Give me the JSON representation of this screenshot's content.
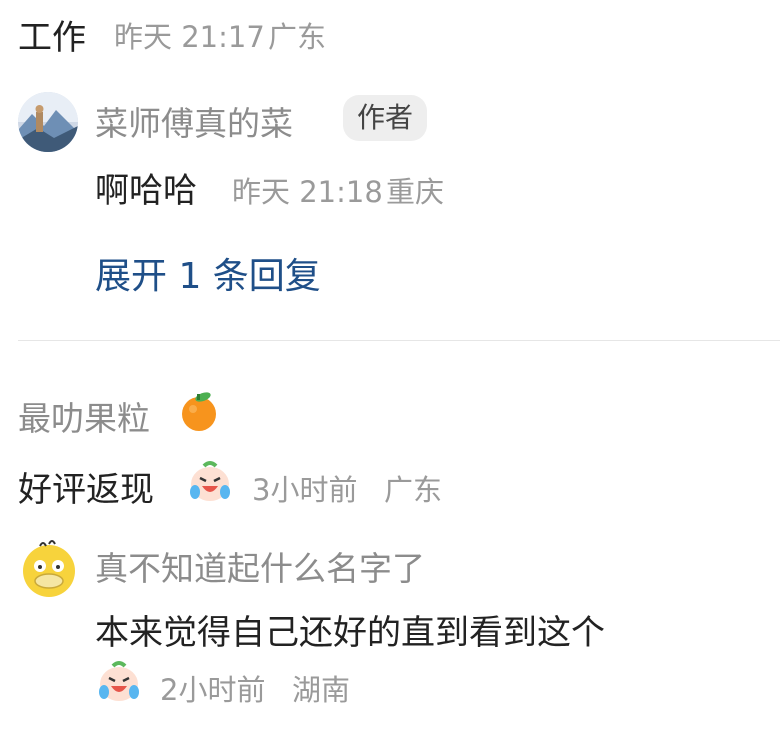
{
  "top_comment": {
    "text": "工作",
    "time": "昨天 21:17",
    "location": "广东"
  },
  "reply": {
    "author": "菜师傅真的菜",
    "author_badge": "作者",
    "text": "啊哈哈",
    "time": "昨天 21:18",
    "location": "重庆",
    "avatar_icon": "mountain-landscape-avatar"
  },
  "expand_replies": "展开 1 条回复",
  "comment2": {
    "author": "最叻果粒",
    "author_emoji": "tangerine-emoji",
    "text": "好评返现",
    "text_emoji": "crying-laughing-peach-emoji",
    "time": "3小时前",
    "location": "广东"
  },
  "comment3": {
    "author": "真不知道起什么名字了",
    "text": "本来觉得自己还好的直到看到这个",
    "text_emoji": "crying-laughing-peach-emoji",
    "time": "2小时前",
    "location": "湖南",
    "avatar_icon": "yellow-duck-avatar"
  },
  "colors": {
    "link": "#1f4f88",
    "meta": "#9a9a9a",
    "badge_bg": "#eeeeee"
  }
}
